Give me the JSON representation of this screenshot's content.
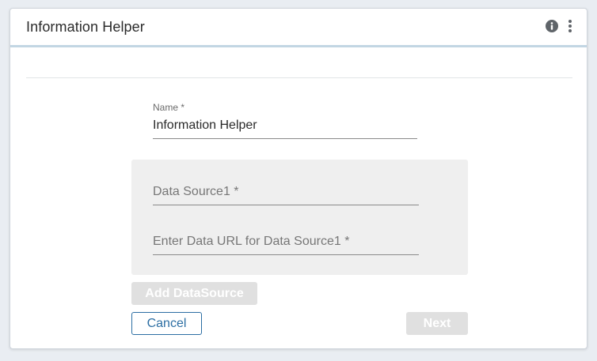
{
  "header": {
    "title": "Information Helper",
    "info_icon": "info-circle-icon",
    "menu_icon": "vertical-ellipsis-icon"
  },
  "form": {
    "name_label": "Name *",
    "name_value": "Information Helper",
    "data_sources": [
      {
        "name_placeholder": "Data Source1 *",
        "url_placeholder": "Enter Data URL for Data Source1 *"
      }
    ]
  },
  "actions": {
    "add_datasource_label": "Add DataSource",
    "cancel_label": "Cancel",
    "next_label": "Next"
  },
  "colors": {
    "accent": "#2c6ea3",
    "header_border": "#c2d6e3",
    "disabled_button": "#e0e0e0",
    "panel_bg": "#efefef"
  }
}
